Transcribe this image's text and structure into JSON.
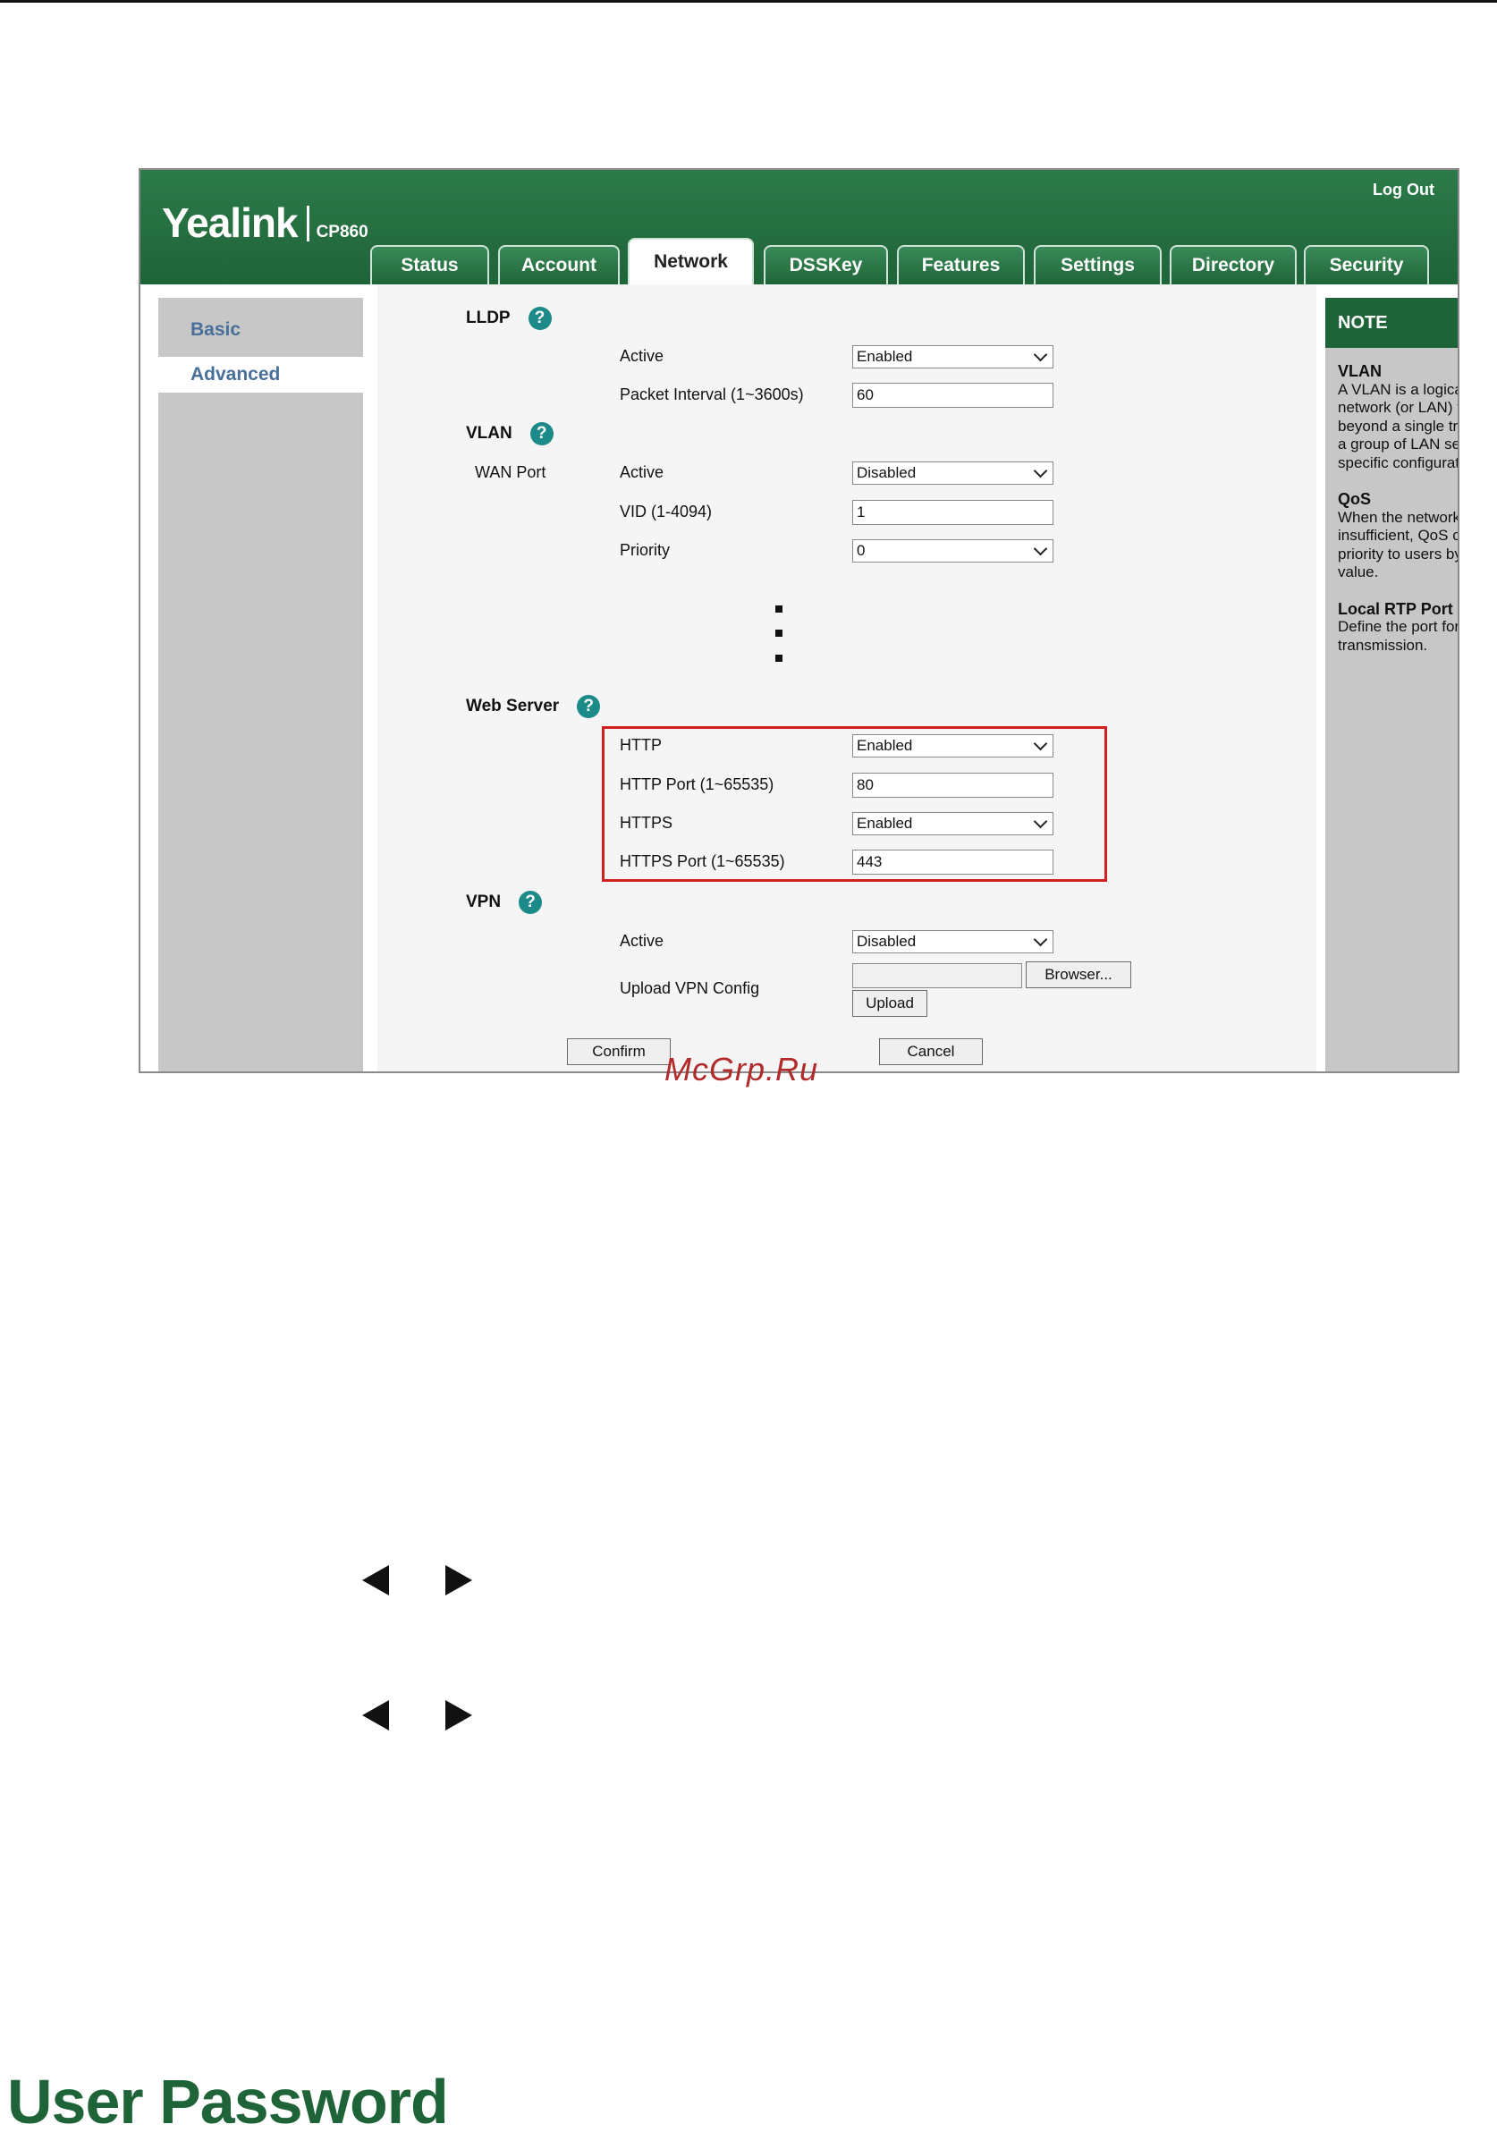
{
  "logo": {
    "word": "Yealink",
    "model": "CP860"
  },
  "header": {
    "logout": "Log Out"
  },
  "tabs": [
    "Status",
    "Account",
    "Network",
    "DSSKey",
    "Features",
    "Settings",
    "Directory",
    "Security"
  ],
  "active_tab": "Network",
  "nav": {
    "basic": "Basic",
    "advanced": "Advanced"
  },
  "lldp": {
    "title": "LLDP",
    "active_label": "Active",
    "active_value": "Enabled",
    "interval_label": "Packet Interval (1~3600s)",
    "interval_value": "60"
  },
  "vlan": {
    "title": "VLAN",
    "wan_port": "WAN Port",
    "active_label": "Active",
    "active_value": "Disabled",
    "vid_label": "VID (1-4094)",
    "vid_value": "1",
    "priority_label": "Priority",
    "priority_value": "0"
  },
  "web_server": {
    "title": "Web Server",
    "http_label": "HTTP",
    "http_value": "Enabled",
    "http_port_label": "HTTP Port (1~65535)",
    "http_port_value": "80",
    "https_label": "HTTPS",
    "https_value": "Enabled",
    "https_port_label": "HTTPS Port (1~65535)",
    "https_port_value": "443"
  },
  "vpn": {
    "title": "VPN",
    "active_label": "Active",
    "active_value": "Disabled",
    "upload_label": "Upload VPN Config",
    "browse_button": "Browser...",
    "upload_button": "Upload"
  },
  "actions": {
    "confirm": "Confirm",
    "cancel": "Cancel"
  },
  "help_glyph": "?",
  "note": {
    "title": "NOTE",
    "vlan_title": "VLAN",
    "vlan_text": "A VLAN is a logical local area network (or LAN) that extends beyond a single traditional LAN to a group of LAN segments, given specific configurations.",
    "qos_title": "QoS",
    "qos_text": "When the network capacity is insufficient, QoS could provide priority to users by setting the value.",
    "rtp_title": "Local RTP Port",
    "rtp_text": "Define the port for voice transmission."
  },
  "watermark": "McGrp.Ru",
  "section_heading": "User Password",
  "colors": {
    "brand_green": "#1f6438",
    "highlight_red": "#d22020",
    "note_accent": "#e8821e"
  }
}
